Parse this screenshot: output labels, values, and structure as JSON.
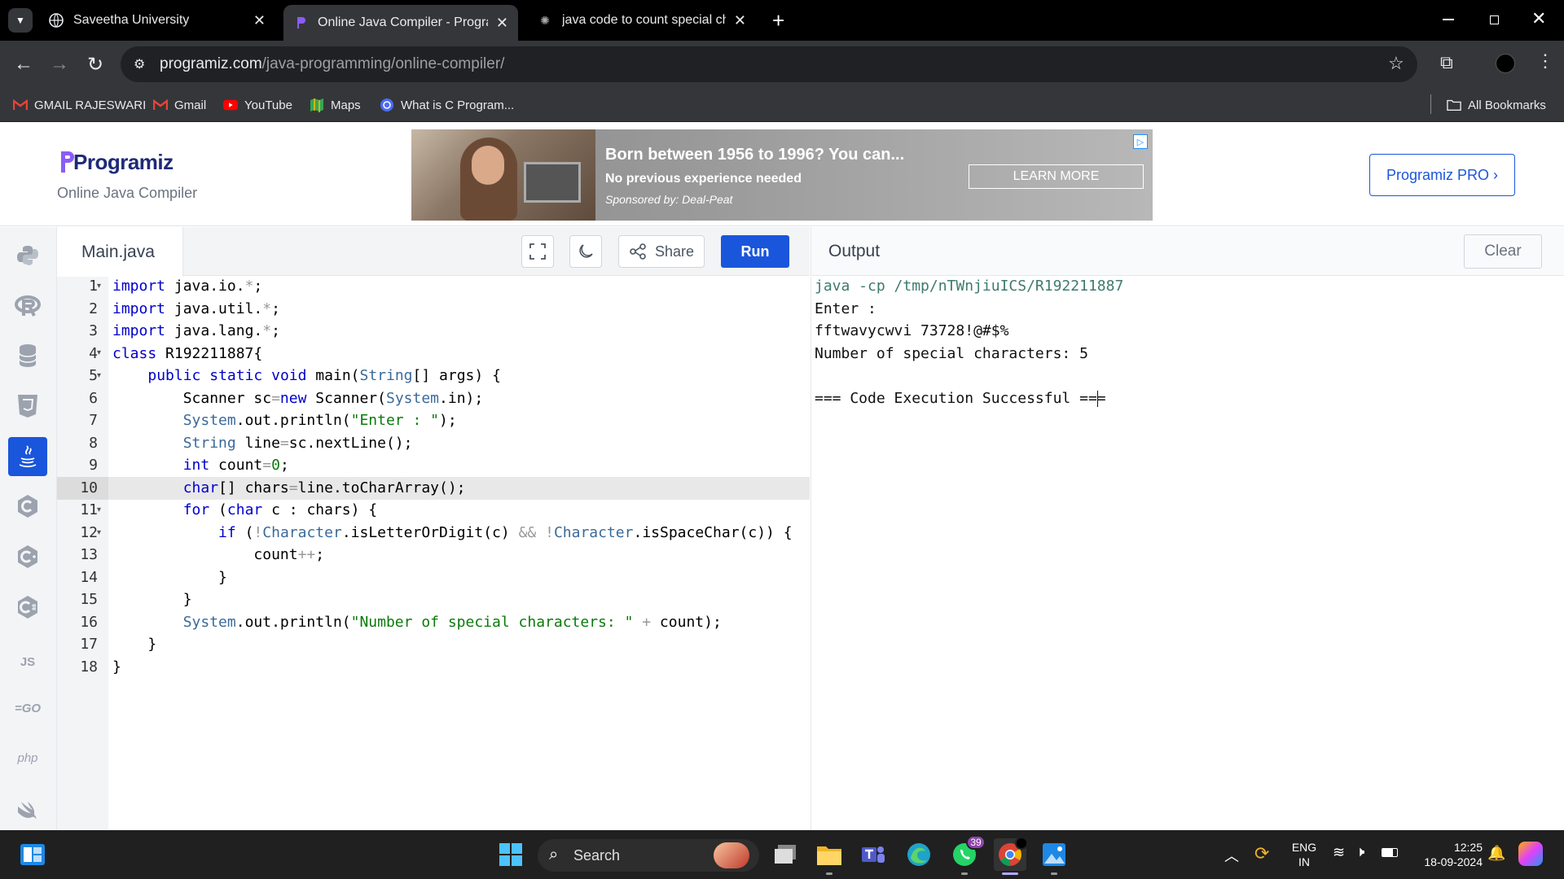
{
  "browser": {
    "tabs": [
      {
        "title": "Saveetha University"
      },
      {
        "title": "Online Java Compiler - Program"
      },
      {
        "title": "java code to count special chara"
      }
    ],
    "url_domain": "programiz.com",
    "url_path": "/java-programming/online-compiler/",
    "bookmarks": [
      {
        "label": "GMAIL RAJESWARI"
      },
      {
        "label": "Gmail"
      },
      {
        "label": "YouTube"
      },
      {
        "label": "Maps"
      },
      {
        "label": "What is C Program..."
      }
    ],
    "all_bookmarks": "All Bookmarks"
  },
  "site": {
    "logo": "Programiz",
    "subtitle": "Online Java Compiler",
    "pro_button": "Programiz PRO ›"
  },
  "ad": {
    "headline": "Born between 1956 to 1996? You can...",
    "line2": "No previous experience needed",
    "sponsor": "Sponsored by: Deal-Peat",
    "cta": "LEARN MORE"
  },
  "sidebar": {
    "items": [
      "python",
      "r",
      "sql",
      "html",
      "java",
      "c",
      "cpp",
      "csharp",
      "JS",
      "GO",
      "php",
      "swift"
    ]
  },
  "editor": {
    "filename": "Main.java",
    "share_label": "Share",
    "run_label": "Run",
    "active_line": 10,
    "lines": [
      "1",
      "2",
      "3",
      "4",
      "5",
      "6",
      "7",
      "8",
      "9",
      "10",
      "11",
      "12",
      "13",
      "14",
      "15",
      "16",
      "17",
      "18"
    ]
  },
  "output": {
    "title": "Output",
    "clear_label": "Clear",
    "lines": [
      "java -cp /tmp/nTWnjiuICS/R192211887",
      "Enter :",
      "fftwavycwvi 73728!@#$%",
      "Number of special characters: 5",
      "",
      "=== Code Execution Successful ==="
    ]
  },
  "taskbar": {
    "search": "Search",
    "whatsapp_badge": "39",
    "lang_top": "ENG",
    "lang_bottom": "IN",
    "time": "12:25",
    "date": "18-09-2024"
  },
  "colors": {
    "accent": "#1a56db",
    "keyword": "#0000cd",
    "string": "#0a7a0a"
  }
}
